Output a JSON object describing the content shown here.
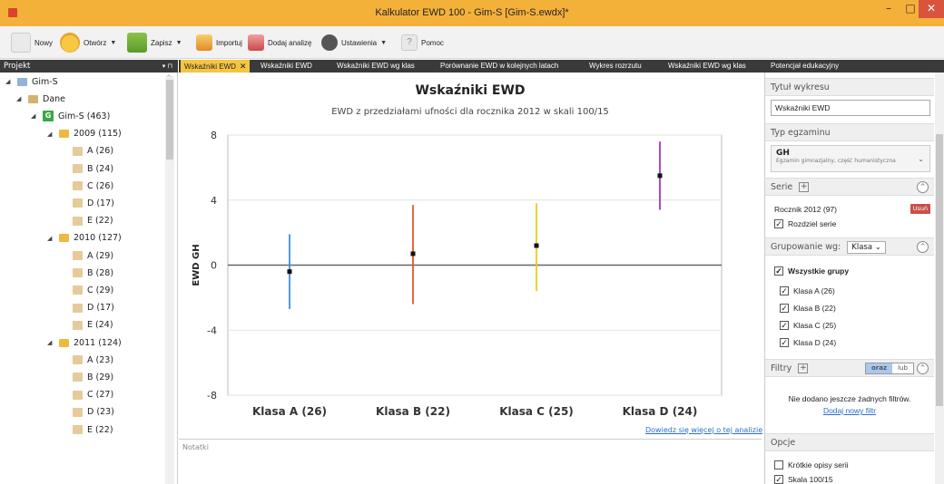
{
  "window": {
    "title": "Kalkulator EWD 100 - Gim-S [Gim-S.ewdx]*",
    "min_glyph": "–",
    "max_glyph": "□",
    "close_glyph": "✕"
  },
  "toolbar": {
    "new": "Nowy",
    "open": "Otwórz",
    "save": "Zapisz",
    "import": "Importuj",
    "add_analysis": "Dodaj analizę",
    "settings": "Ustawienia",
    "help": "Pomoc",
    "dropdown_glyph": "▼"
  },
  "left_panel": {
    "header": "Projekt",
    "pin_glyph": "▾ ⊓",
    "tree": [
      {
        "label": "Gim-S",
        "level": 0,
        "icon": "project",
        "expanded": true
      },
      {
        "label": "Dane",
        "level": 1,
        "icon": "folder",
        "expanded": true
      },
      {
        "label": "Gim-S (463)",
        "level": 2,
        "icon": "school",
        "expanded": true
      },
      {
        "label": "2009 (115)",
        "level": 3,
        "icon": "year",
        "expanded": true
      },
      {
        "label": "A (26)",
        "level": 4,
        "icon": "class"
      },
      {
        "label": "B (24)",
        "level": 4,
        "icon": "class"
      },
      {
        "label": "C (26)",
        "level": 4,
        "icon": "class"
      },
      {
        "label": "D (17)",
        "level": 4,
        "icon": "class"
      },
      {
        "label": "E (22)",
        "level": 4,
        "icon": "class"
      },
      {
        "label": "2010 (127)",
        "level": 3,
        "icon": "year",
        "expanded": true
      },
      {
        "label": "A (29)",
        "level": 4,
        "icon": "class"
      },
      {
        "label": "B (28)",
        "level": 4,
        "icon": "class"
      },
      {
        "label": "C (29)",
        "level": 4,
        "icon": "class"
      },
      {
        "label": "D (17)",
        "level": 4,
        "icon": "class"
      },
      {
        "label": "E (24)",
        "level": 4,
        "icon": "class"
      },
      {
        "label": "2011 (124)",
        "level": 3,
        "icon": "year",
        "expanded": true
      },
      {
        "label": "A (23)",
        "level": 4,
        "icon": "class"
      },
      {
        "label": "B (29)",
        "level": 4,
        "icon": "class"
      },
      {
        "label": "C (27)",
        "level": 4,
        "icon": "class"
      },
      {
        "label": "D (23)",
        "level": 4,
        "icon": "class"
      },
      {
        "label": "E (22)",
        "level": 4,
        "icon": "class"
      }
    ]
  },
  "tabs": [
    {
      "label": "Wskaźniki EWD",
      "active": true
    },
    {
      "label": "Wskaźniki EWD",
      "active": false
    },
    {
      "label": "Wskaźniki EWD wg klas",
      "active": false
    },
    {
      "label": "Porównanie EWD w kolejnych latach",
      "active": false
    },
    {
      "label": "Wykres rozrzutu",
      "active": false
    },
    {
      "label": "Wskaźniki EWD wg klas",
      "active": false
    },
    {
      "label": "Potencjał edukacyjny",
      "active": false
    }
  ],
  "tab_close_glyph": "✕",
  "chart_data": {
    "type": "scatter",
    "title": "Wskaźniki EWD",
    "subtitle": "EWD z przedziałami ufności dla rocznika 2012 w skali 100/15",
    "ylabel": "EWD GH",
    "xlabel": "",
    "ylim": [
      -8,
      8
    ],
    "yticks": [
      "8",
      "4",
      "0",
      "-4",
      "-8"
    ],
    "categories": [
      "Klasa A (26)",
      "Klasa B (22)",
      "Klasa C (25)",
      "Klasa D (24)"
    ],
    "values": [
      -0.4,
      0.7,
      1.2,
      5.5
    ],
    "lower": [
      -2.7,
      -2.4,
      -1.6,
      3.4
    ],
    "upper": [
      1.9,
      3.7,
      3.8,
      7.6
    ],
    "colors": [
      "#3b8fe0",
      "#e8552b",
      "#f2c81e",
      "#a236c9"
    ],
    "grid": true,
    "legend": "none"
  },
  "chart_link": "Dowiedz się więcej o tej analizie",
  "notes_label": "Notatki",
  "right_panel": {
    "chart_title_head": "Tytuł wykresu",
    "chart_title_value": "Wskaźniki EWD",
    "exam_head": "Typ egzaminu",
    "exam_code": "GH",
    "exam_desc": "Egzamin gimnazjalny, część humanistyczna",
    "series_head": "Serie",
    "series_item": "Rocznik 2012 (97)",
    "remove": "Usuń",
    "split_series": "Rozdziel serie",
    "grouping_head": "Grupowanie wg:",
    "grouping_value": "Klasa",
    "all_groups": "Wszystkie grupy",
    "groups": [
      "Klasa A (26)",
      "Klasa B (22)",
      "Klasa C (25)",
      "Klasa D (24)"
    ],
    "filters_head": "Filtry",
    "and": "oraz",
    "or": "lub",
    "no_filters": "Nie dodano jeszcze żadnych filtrów.",
    "add_filter": "Dodaj nowy filtr",
    "options_head": "Opcje",
    "short_desc": "Krótkie opisy serii",
    "scale": "Skala 100/15",
    "plus_glyph": "+",
    "collapse_glyph": "^",
    "chevron_glyph": "⌄",
    "check_glyph": "✓"
  }
}
